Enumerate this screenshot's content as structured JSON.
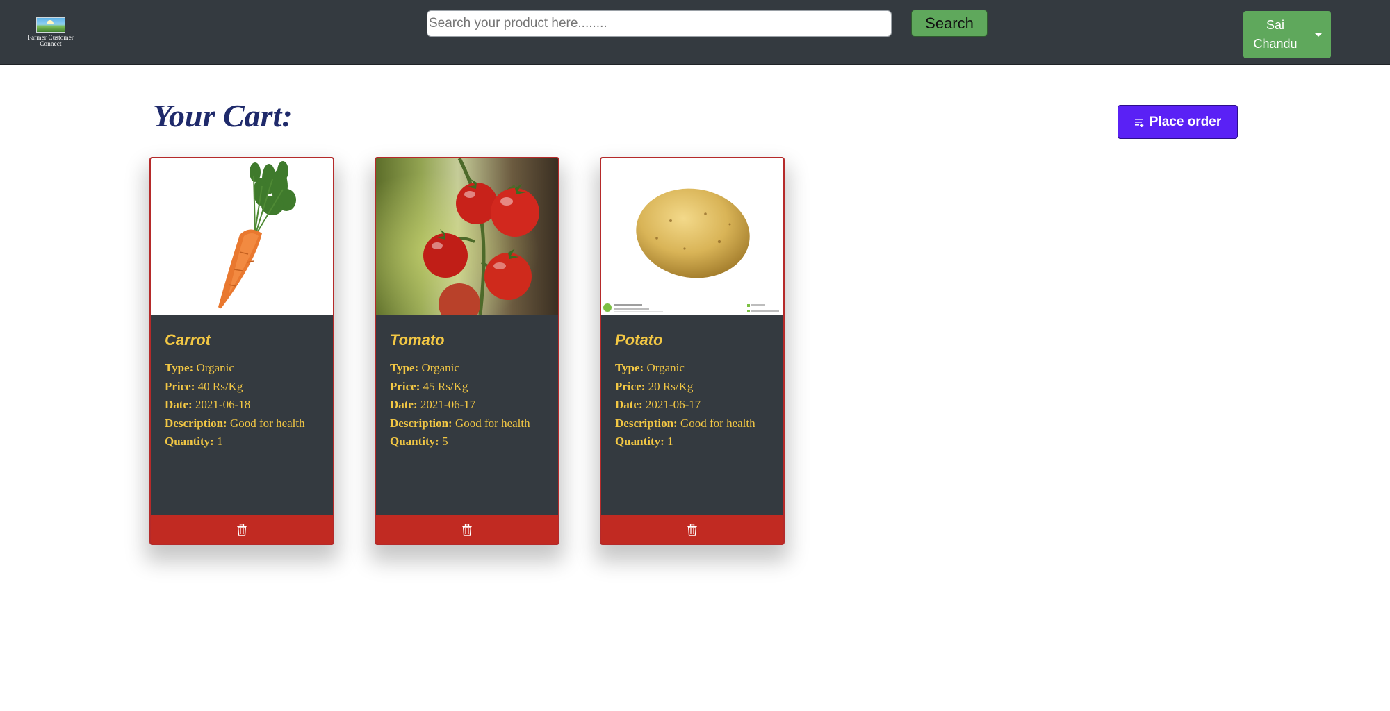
{
  "brand": {
    "logo_text_line1": "Farmer Customer",
    "logo_text_line2": "Connect"
  },
  "search": {
    "placeholder": "Search your product here........",
    "button_label": "Search"
  },
  "user": {
    "name_line1": "Sai",
    "name_line2": "Chandu"
  },
  "page": {
    "title": "Your Cart:",
    "place_order_label": "Place order"
  },
  "labels": {
    "type": "Type:",
    "price": "Price:",
    "date": "Date:",
    "description": "Description:",
    "quantity": "Quantity:"
  },
  "cart_items": [
    {
      "name": "Carrot",
      "type": "Organic",
      "price": "40 Rs/Kg",
      "date": "2021-06-18",
      "description": "Good for health",
      "quantity": "1"
    },
    {
      "name": "Tomato",
      "type": "Organic",
      "price": "45 Rs/Kg",
      "date": "2021-06-17",
      "description": "Good for health",
      "quantity": "5"
    },
    {
      "name": "Potato",
      "type": "Organic",
      "price": "20 Rs/Kg",
      "date": "2021-06-17",
      "description": "Good for health",
      "quantity": "1"
    }
  ],
  "colors": {
    "navbar": "#343a40",
    "search_button": "#5fa85c",
    "place_order": "#5a21f5",
    "card_text": "#f2c744",
    "delete_button": "#c12a22",
    "title": "#1f2a6b"
  },
  "icons": {
    "place_order": "list-icon",
    "delete": "trash-icon",
    "user_menu": "caret-down-icon"
  }
}
